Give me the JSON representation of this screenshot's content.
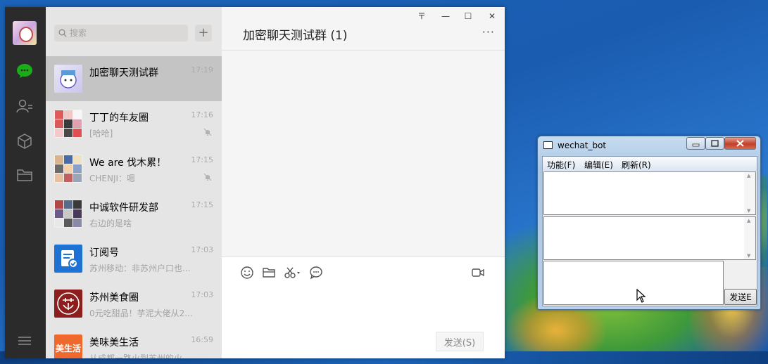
{
  "wechat": {
    "window_controls": {
      "pin": "〒",
      "minimize": "—",
      "maximize": "☐",
      "close": "✕"
    },
    "search": {
      "placeholder": "搜索"
    },
    "add_label": "+",
    "chats": [
      {
        "name": "加密聊天测试群",
        "time": "17:19",
        "preview": "",
        "active": true,
        "muted": false,
        "avatar": "anime"
      },
      {
        "name": "丁丁的车友圈",
        "time": "17:16",
        "preview": "[哈哈]",
        "active": false,
        "muted": true,
        "avatar": "grid"
      },
      {
        "name": "We are 伐木累！",
        "time": "17:15",
        "preview": "CHENJI：嗯",
        "active": false,
        "muted": true,
        "avatar": "grid"
      },
      {
        "name": "中诚软件研发部",
        "time": "17:15",
        "preview": "右边的是啥",
        "active": false,
        "muted": false,
        "avatar": "grid"
      },
      {
        "name": "订阅号",
        "time": "17:03",
        "preview": "苏州移动：非苏州户口也...",
        "active": false,
        "muted": false,
        "avatar": "subscription"
      },
      {
        "name": "苏州美食圈",
        "time": "17:03",
        "preview": "0元吃甜品！芋泥大佬从2...",
        "active": false,
        "muted": false,
        "avatar": "suzhou"
      },
      {
        "name": "美味美生活",
        "time": "16:59",
        "preview": "从成都一路火到苏州的火...",
        "active": false,
        "muted": false,
        "avatar": "meishenghuo",
        "avatar_text": "美生活"
      }
    ],
    "main": {
      "title": "加密聊天测试群 (1)",
      "more_label": "···",
      "send_label": "发送(S)"
    },
    "colors": {
      "rail": "#2b2b2b",
      "list": "#e6e5e5",
      "active_item": "#c5c4c4",
      "accent_green": "#1aad19"
    }
  },
  "bot": {
    "title": "wechat_bot",
    "menus": [
      "功能(F)",
      "编辑(E)",
      "刷新(R)"
    ],
    "send_label": "发送E"
  }
}
